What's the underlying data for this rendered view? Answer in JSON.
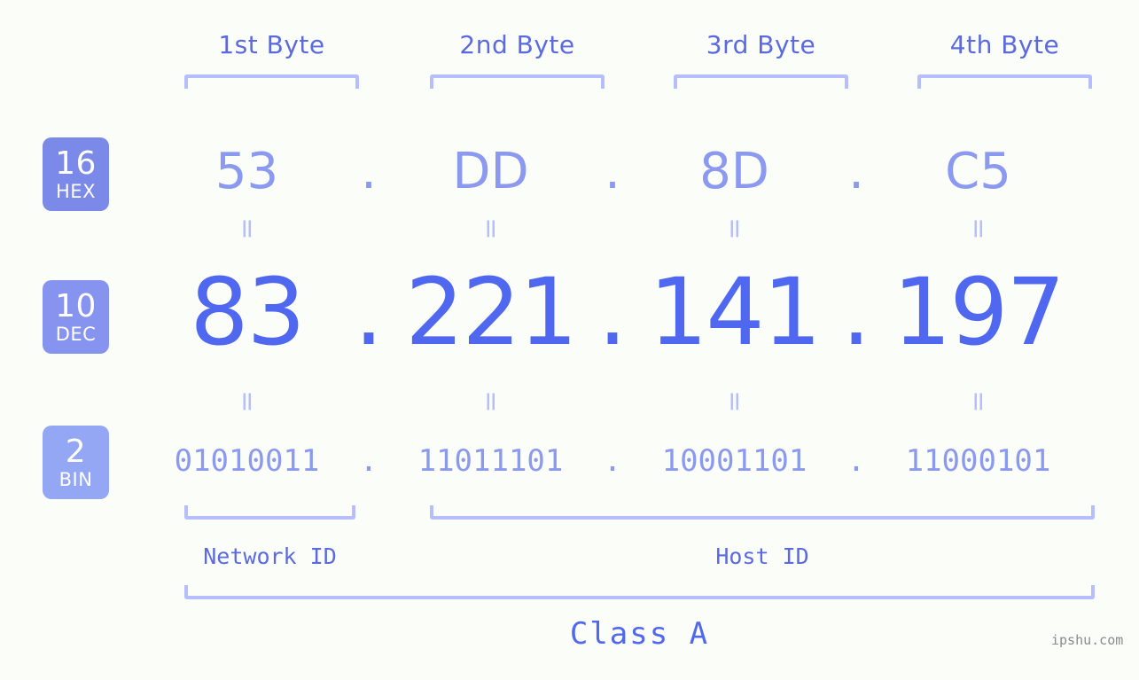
{
  "colors": {
    "background": "#fbfdf8",
    "accent_strong": "#5068ef",
    "accent_mid": "#5b6ae0",
    "accent_light": "#8b99f0",
    "accent_pale": "#b6bffb",
    "badge_hex": "#7b89e8",
    "badge_dec": "#8794ef",
    "badge_bin": "#93a7f5",
    "watermark": "#8a8a8a"
  },
  "byte_headers": [
    {
      "label": "1st Byte"
    },
    {
      "label": "2nd Byte"
    },
    {
      "label": "3rd Byte"
    },
    {
      "label": "4th Byte"
    }
  ],
  "bases": [
    {
      "number": "16",
      "name": "HEX"
    },
    {
      "number": "10",
      "name": "DEC"
    },
    {
      "number": "2",
      "name": "BIN"
    }
  ],
  "separator": ".",
  "equality_mark": "=",
  "rows": {
    "hex": {
      "base": "16",
      "base_name": "HEX",
      "octets": [
        "53",
        "DD",
        "8D",
        "C5"
      ]
    },
    "dec": {
      "base": "10",
      "base_name": "DEC",
      "octets": [
        "83",
        "221",
        "141",
        "197"
      ]
    },
    "bin": {
      "base": "2",
      "base_name": "BIN",
      "octets": [
        "01010011",
        "11011101",
        "10001101",
        "11000101"
      ]
    }
  },
  "segments": {
    "network_id": "Network ID",
    "host_id": "Host ID"
  },
  "class": "Class A",
  "watermark": "ipshu.com"
}
